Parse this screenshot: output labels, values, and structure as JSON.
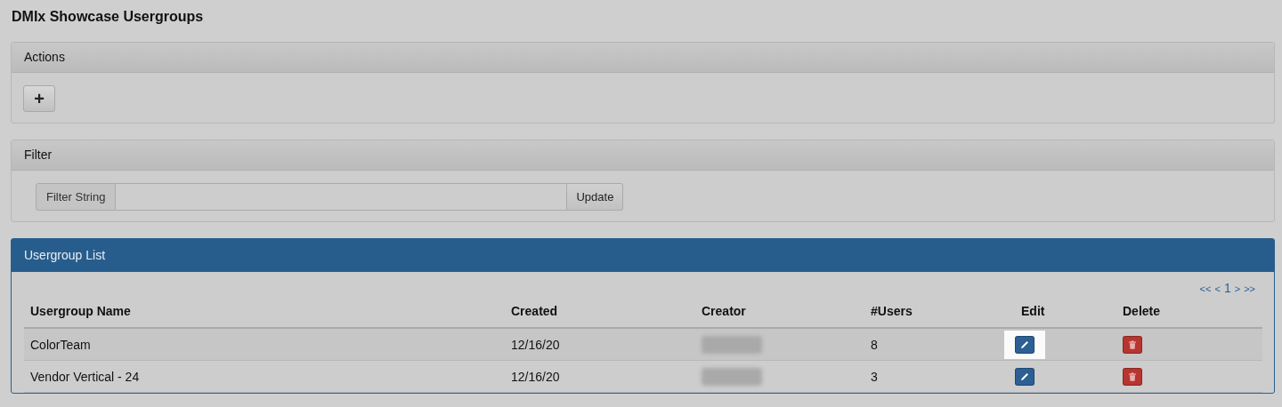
{
  "page_title": "DMIx Showcase Usergroups",
  "actions_panel": {
    "title": "Actions",
    "add_button": "+"
  },
  "filter_panel": {
    "title": "Filter",
    "label": "Filter String",
    "button": "Update"
  },
  "list_panel": {
    "title": "Usergroup List",
    "pagination": [
      "<<",
      "<",
      "1",
      ">",
      ">>"
    ],
    "columns": [
      "Usergroup Name",
      "Created",
      "Creator",
      "#Users",
      "Edit",
      "Delete"
    ],
    "rows": [
      {
        "name": "ColorTeam",
        "created": "12/16/20",
        "users": "8",
        "edit_highlighted": true
      },
      {
        "name": "Vendor Vertical - 24",
        "created": "12/16/20",
        "users": "3",
        "edit_highlighted": false
      }
    ]
  }
}
